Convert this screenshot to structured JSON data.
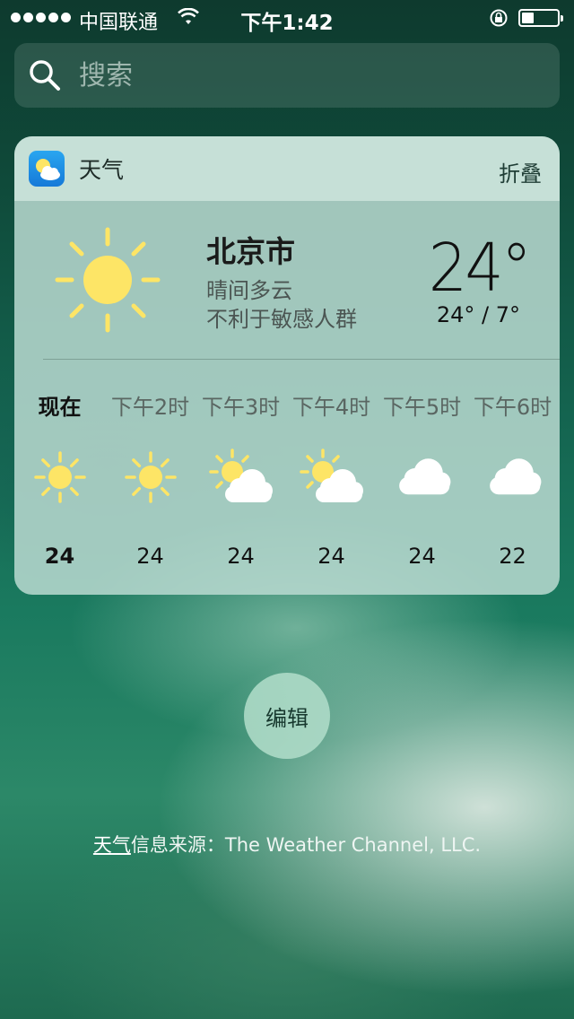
{
  "status_bar": {
    "carrier": "中国联通",
    "time": "下午1:42",
    "battery_level": 0.35
  },
  "search": {
    "placeholder": "搜索"
  },
  "weather_widget": {
    "app_name": "天气",
    "collapse_label": "折叠",
    "current": {
      "city": "北京市",
      "condition": "晴间多云",
      "air_quality": "不利于敏感人群",
      "temperature": "24°",
      "high_low": "24° / 7°",
      "icon": "sun-icon"
    },
    "hourly": [
      {
        "label": "现在",
        "temp": "24",
        "icon": "sun-icon"
      },
      {
        "label": "下午2时",
        "temp": "24",
        "icon": "sun-icon"
      },
      {
        "label": "下午3时",
        "temp": "24",
        "icon": "partly-cloudy-icon"
      },
      {
        "label": "下午4时",
        "temp": "24",
        "icon": "partly-cloudy-icon"
      },
      {
        "label": "下午5时",
        "temp": "24",
        "icon": "cloud-icon"
      },
      {
        "label": "下午6时",
        "temp": "22",
        "icon": "cloud-icon"
      }
    ]
  },
  "edit_label": "编辑",
  "source": {
    "link": "天气",
    "text": "信息来源：The Weather Channel, LLC."
  },
  "colors": {
    "sun": "#fde566",
    "cloud": "#ffffff",
    "app_icon": "#1f8fe6"
  }
}
